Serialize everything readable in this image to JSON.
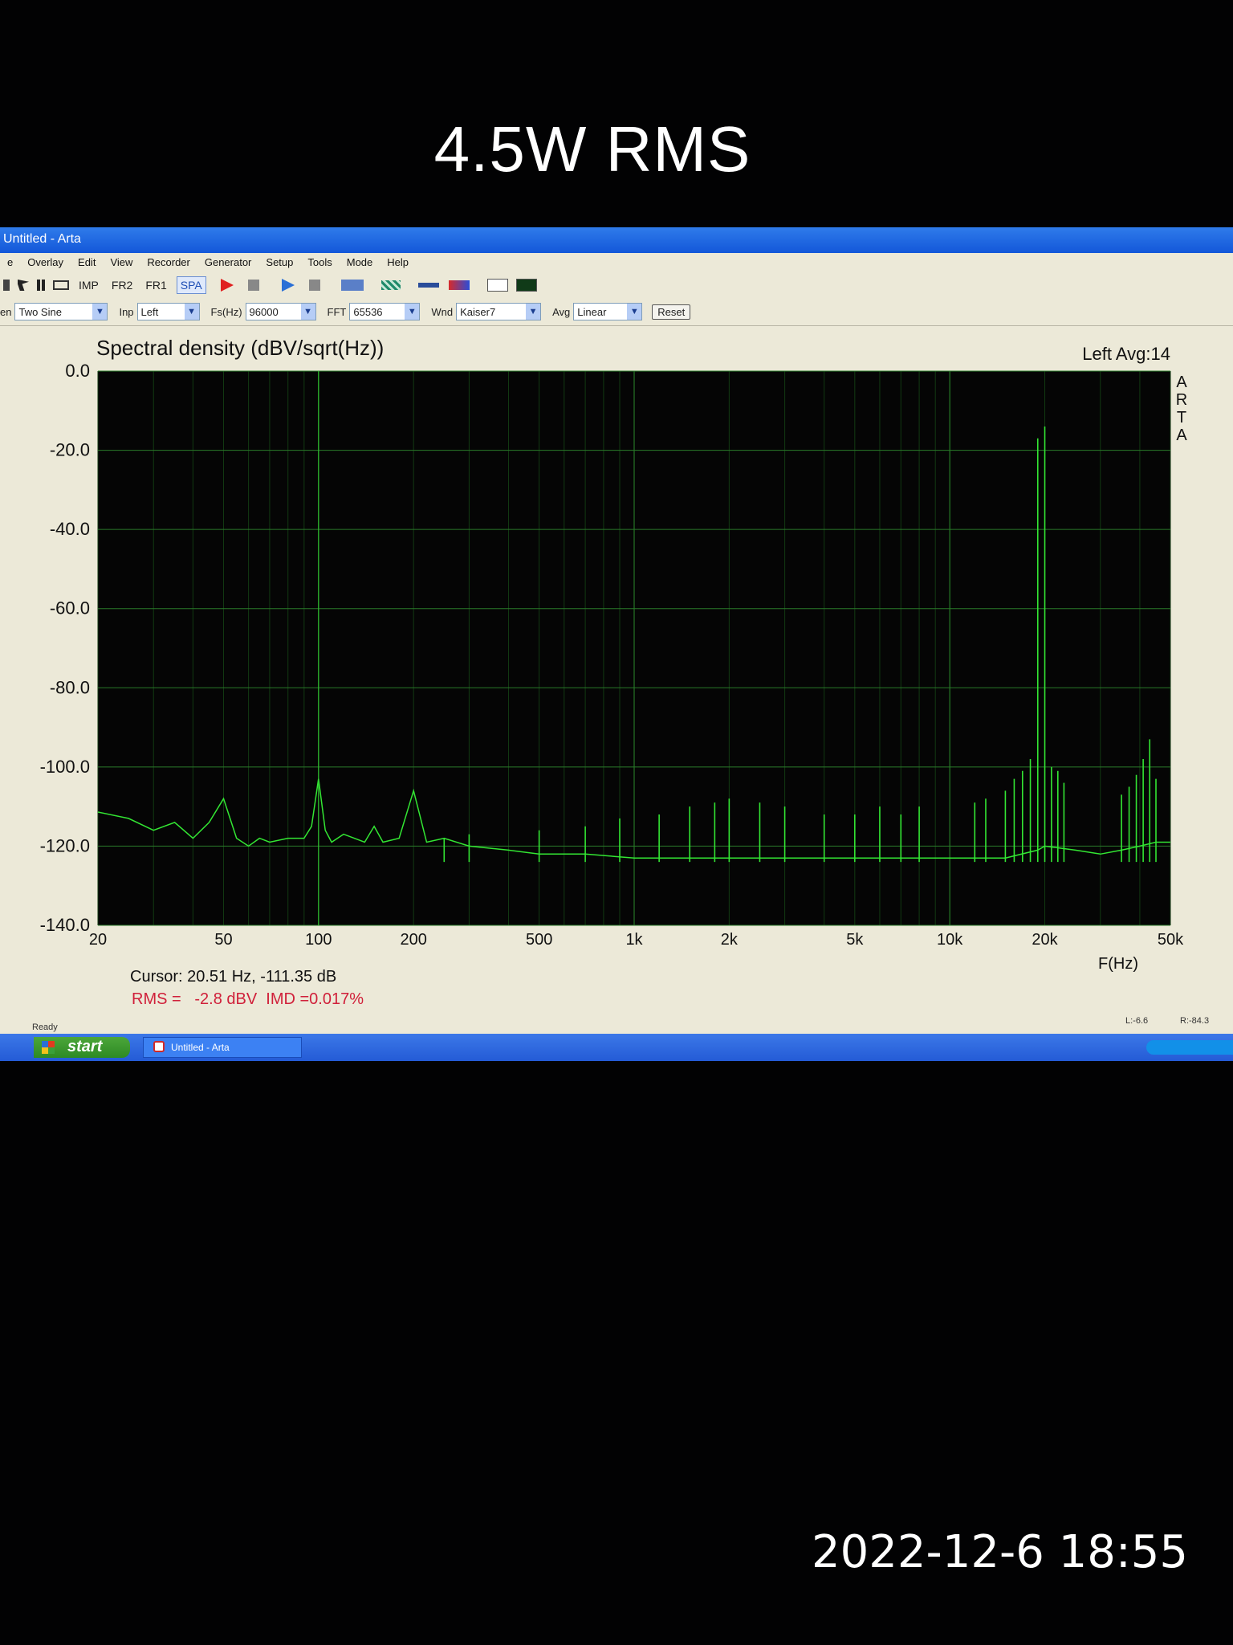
{
  "overlay_title": "4.5W RMS",
  "photo_date": "2022-12-6 18:55",
  "window": {
    "title": "Untitled - Arta",
    "menu": [
      "e",
      "Overlay",
      "Edit",
      "View",
      "Recorder",
      "Generator",
      "Setup",
      "Tools",
      "Mode",
      "Help"
    ],
    "toolbar": [
      "IMP",
      "FR2",
      "FR1",
      "SPA"
    ],
    "active_tool": "SPA",
    "params": {
      "gen_label": "en",
      "gen_value": "Two Sine",
      "inp_label": "Inp",
      "inp_value": "Left",
      "fs_label": "Fs(Hz)",
      "fs_value": "96000",
      "fft_label": "FFT",
      "fft_value": "65536",
      "wnd_label": "Wnd",
      "wnd_value": "Kaiser7",
      "avg_label": "Avg",
      "avg_value": "Linear",
      "reset_label": "Reset"
    },
    "status": {
      "left": "Ready",
      "l_level": "L:-6.6",
      "r_level": "R:-84.3"
    },
    "taskbar": {
      "start_label": "start",
      "task_label": "Untitled - Arta"
    }
  },
  "chart_data": {
    "type": "line",
    "title": "Spectral density (dBV/sqrt(Hz))",
    "channel_label": "Left  Avg:14",
    "watermark": "ARTA",
    "xlabel": "F(Hz)",
    "x_scale": "log",
    "xlim": [
      20,
      50000
    ],
    "ylim": [
      -140,
      0
    ],
    "x_ticks": [
      {
        "v": 20,
        "label": "20"
      },
      {
        "v": 50,
        "label": "50"
      },
      {
        "v": 100,
        "label": "100"
      },
      {
        "v": 200,
        "label": "200"
      },
      {
        "v": 500,
        "label": "500"
      },
      {
        "v": 1000,
        "label": "1k"
      },
      {
        "v": 2000,
        "label": "2k"
      },
      {
        "v": 5000,
        "label": "5k"
      },
      {
        "v": 10000,
        "label": "10k"
      },
      {
        "v": 20000,
        "label": "20k"
      },
      {
        "v": 50000,
        "label": "50k"
      }
    ],
    "y_ticks": [
      {
        "v": 0,
        "label": "0.0"
      },
      {
        "v": -20,
        "label": "-20.0"
      },
      {
        "v": -40,
        "label": "-40.0"
      },
      {
        "v": -60,
        "label": "-60.0"
      },
      {
        "v": -80,
        "label": "-80.0"
      },
      {
        "v": -100,
        "label": "-100.0"
      },
      {
        "v": -120,
        "label": "-120.0"
      },
      {
        "v": -140,
        "label": "-140.0"
      }
    ],
    "grid": true,
    "series": [
      {
        "color": "#33e633",
        "points": [
          [
            20,
            -111.4
          ],
          [
            25,
            -113
          ],
          [
            30,
            -116
          ],
          [
            35,
            -114
          ],
          [
            40,
            -118
          ],
          [
            45,
            -114
          ],
          [
            50,
            -108
          ],
          [
            55,
            -118
          ],
          [
            60,
            -120
          ],
          [
            65,
            -118
          ],
          [
            70,
            -119
          ],
          [
            80,
            -118
          ],
          [
            90,
            -118
          ],
          [
            95,
            -115
          ],
          [
            100,
            -103
          ],
          [
            105,
            -116
          ],
          [
            110,
            -119
          ],
          [
            120,
            -117
          ],
          [
            140,
            -119
          ],
          [
            150,
            -115
          ],
          [
            160,
            -119
          ],
          [
            180,
            -118
          ],
          [
            200,
            -106
          ],
          [
            220,
            -119
          ],
          [
            250,
            -118
          ],
          [
            300,
            -120
          ],
          [
            400,
            -121
          ],
          [
            500,
            -122
          ],
          [
            700,
            -122
          ],
          [
            1000,
            -123
          ],
          [
            1500,
            -123
          ],
          [
            2000,
            -123
          ],
          [
            3000,
            -123
          ],
          [
            5000,
            -123
          ],
          [
            7000,
            -123
          ],
          [
            10000,
            -123
          ],
          [
            15000,
            -123
          ],
          [
            19000,
            -121
          ],
          [
            20000,
            -120
          ],
          [
            25000,
            -121
          ],
          [
            30000,
            -122
          ],
          [
            35000,
            -121
          ],
          [
            40000,
            -120
          ],
          [
            45000,
            -119
          ],
          [
            50000,
            -119
          ]
        ]
      }
    ],
    "peaks": [
      [
        19000,
        -17
      ],
      [
        20000,
        -14
      ],
      [
        18000,
        -98
      ],
      [
        17000,
        -101
      ],
      [
        21000,
        -100
      ],
      [
        22000,
        -101
      ],
      [
        16000,
        -103
      ],
      [
        23000,
        -104
      ],
      [
        15000,
        -106
      ],
      [
        43000,
        -93
      ],
      [
        41000,
        -98
      ],
      [
        39000,
        -102
      ],
      [
        45000,
        -103
      ],
      [
        37000,
        -105
      ],
      [
        35000,
        -107
      ],
      [
        12000,
        -109
      ],
      [
        13000,
        -108
      ],
      [
        8000,
        -110
      ],
      [
        7000,
        -112
      ],
      [
        6000,
        -110
      ],
      [
        5000,
        -112
      ],
      [
        4000,
        -112
      ],
      [
        3000,
        -110
      ],
      [
        2500,
        -109
      ],
      [
        2000,
        -108
      ],
      [
        1800,
        -109
      ],
      [
        1500,
        -110
      ],
      [
        1200,
        -112
      ],
      [
        900,
        -113
      ],
      [
        700,
        -115
      ],
      [
        500,
        -116
      ],
      [
        300,
        -117
      ],
      [
        250,
        -118
      ]
    ],
    "cursor_x": 100,
    "cursor_text": "Cursor: 20.51 Hz, -111.35 dB",
    "rms_text": "RMS =   -2.8 dBV  IMD =0.017%"
  }
}
